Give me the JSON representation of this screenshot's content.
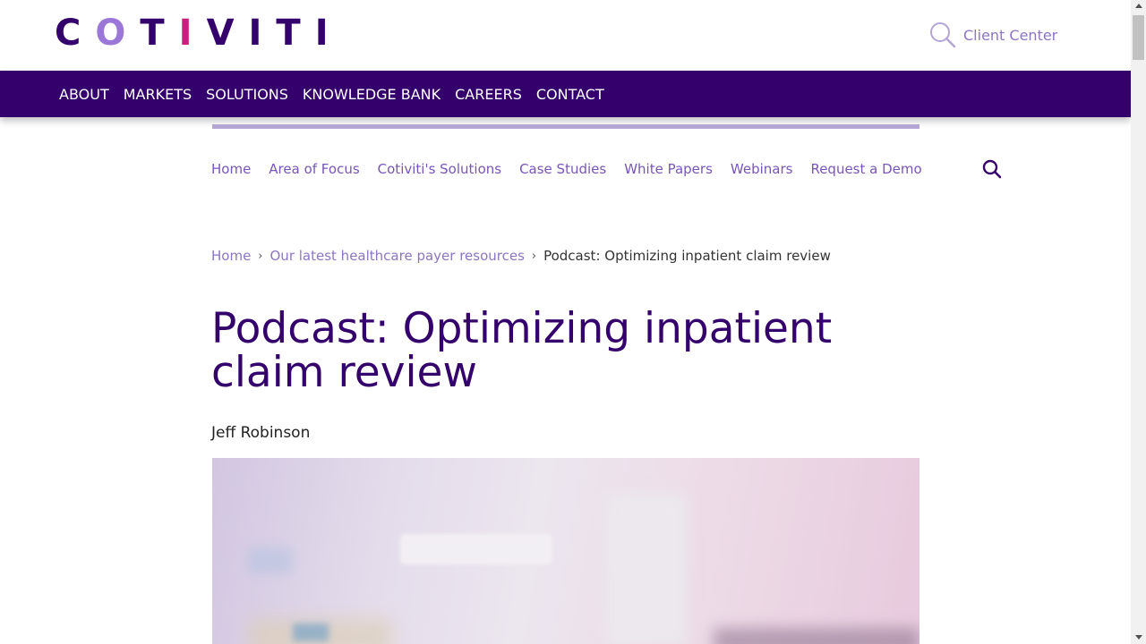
{
  "brand": {
    "logo_text": "COTIVITI",
    "colors": {
      "primary": "#34006b",
      "accent": "#cc1e7f",
      "light": "#9b78d8"
    }
  },
  "header": {
    "client_center": "Client Center",
    "client_icon": "search-icon"
  },
  "main_nav": {
    "items": [
      "ABOUT",
      "MARKETS",
      "SOLUTIONS",
      "KNOWLEDGE BANK",
      "CAREERS",
      "CONTACT"
    ]
  },
  "sub_nav": {
    "items": [
      "Home",
      "Area of Focus",
      "Cotiviti's Solutions",
      "Case Studies",
      "White Papers",
      "Webinars",
      "Request a Demo"
    ],
    "search_icon": "search-icon"
  },
  "breadcrumb": {
    "items": [
      "Home",
      "Our latest healthcare payer resources"
    ],
    "current": "Podcast: Optimizing inpatient claim review"
  },
  "article": {
    "title": "Podcast: Optimizing inpatient claim review",
    "author": "Jeff Robinson"
  }
}
